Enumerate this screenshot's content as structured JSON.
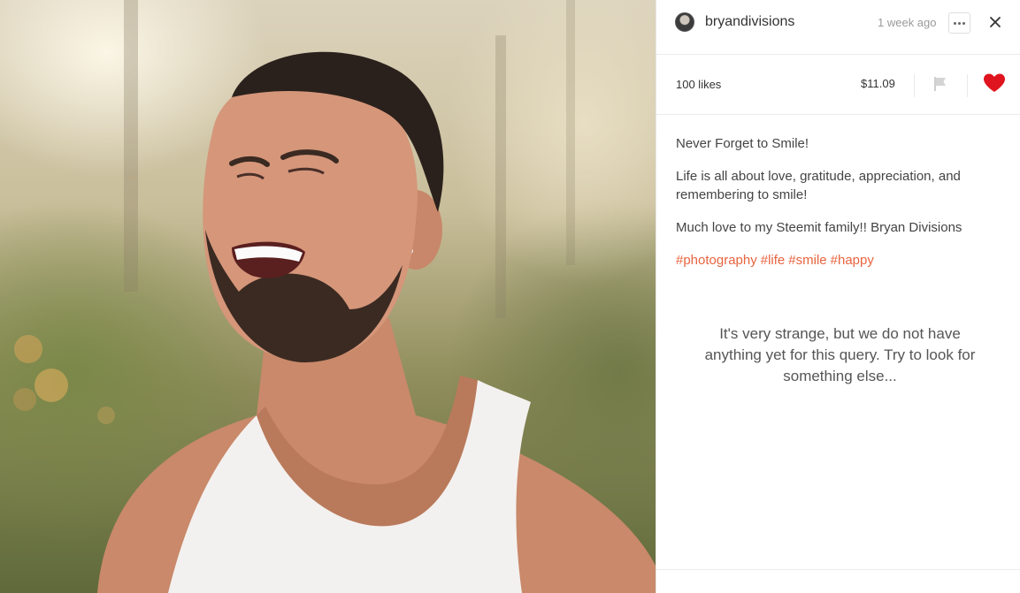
{
  "post": {
    "author": "bryandivisions",
    "time_ago": "1 week ago",
    "likes": "100 likes",
    "payout": "$11.09",
    "paragraphs": [
      "Never Forget to Smile!",
      "Life is all about love, gratitude, appreciation, and remembering to smile!",
      "Much love to my Steemit family!! Bryan Divisions"
    ],
    "tags": [
      "#photography",
      "#life",
      "#smile",
      "#happy"
    ],
    "liked": true
  },
  "comments": {
    "empty_message": "It's very strange, but we do not have anything yet for this query. Try to look for something else..."
  },
  "icons": {
    "more": "more-horizontal-icon",
    "close": "close-icon",
    "flag": "flag-icon",
    "like": "heart-icon"
  },
  "colors": {
    "tag": "#e8643f",
    "heart": "#e0141e",
    "flag": "#cfcfcf"
  }
}
